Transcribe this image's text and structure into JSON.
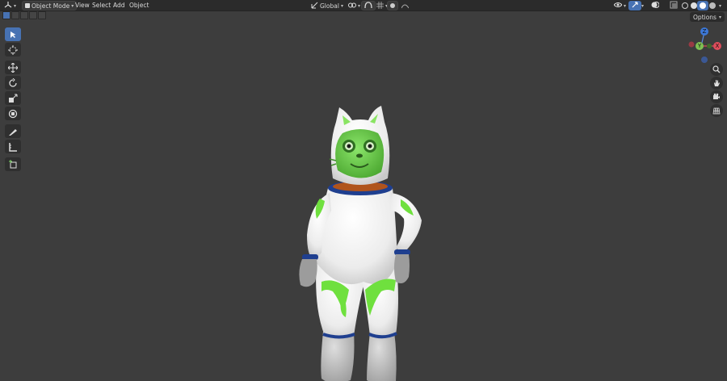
{
  "header": {
    "editor_icon": "3d-viewport-icon",
    "mode": "Object Mode",
    "menus": [
      "View",
      "Select",
      "Add",
      "Object"
    ],
    "orientation": "Global"
  },
  "toolbar": {
    "tools": [
      {
        "name": "select-box-tool",
        "icon": "cursor-icon",
        "active": true
      },
      {
        "name": "cursor-tool",
        "icon": "3d-cursor-icon",
        "active": false
      },
      {
        "name": "move-tool",
        "icon": "move-icon",
        "active": false
      },
      {
        "name": "rotate-tool",
        "icon": "rotate-icon",
        "active": false
      },
      {
        "name": "scale-tool",
        "icon": "scale-icon",
        "active": false
      },
      {
        "name": "transform-tool",
        "icon": "transform-icon",
        "active": false
      },
      {
        "name": "annotate-tool",
        "icon": "annotate-icon",
        "active": false
      },
      {
        "name": "measure-tool",
        "icon": "measure-icon",
        "active": false
      },
      {
        "name": "add-cube-tool",
        "icon": "add-cube-icon",
        "active": false
      }
    ]
  },
  "right_panel": {
    "options_label": "Options",
    "gizmo": {
      "z": "Z",
      "y": "Y",
      "x": "X"
    }
  },
  "colors": {
    "accent": "#4772b3",
    "viewport_bg": "#3d3d3d",
    "suit_white": "#f2f2f2",
    "suit_green": "#6fe03e",
    "face_green": "#5dc43a",
    "collar_orange": "#b0541c",
    "cuff_blue": "#1f3f8f"
  }
}
